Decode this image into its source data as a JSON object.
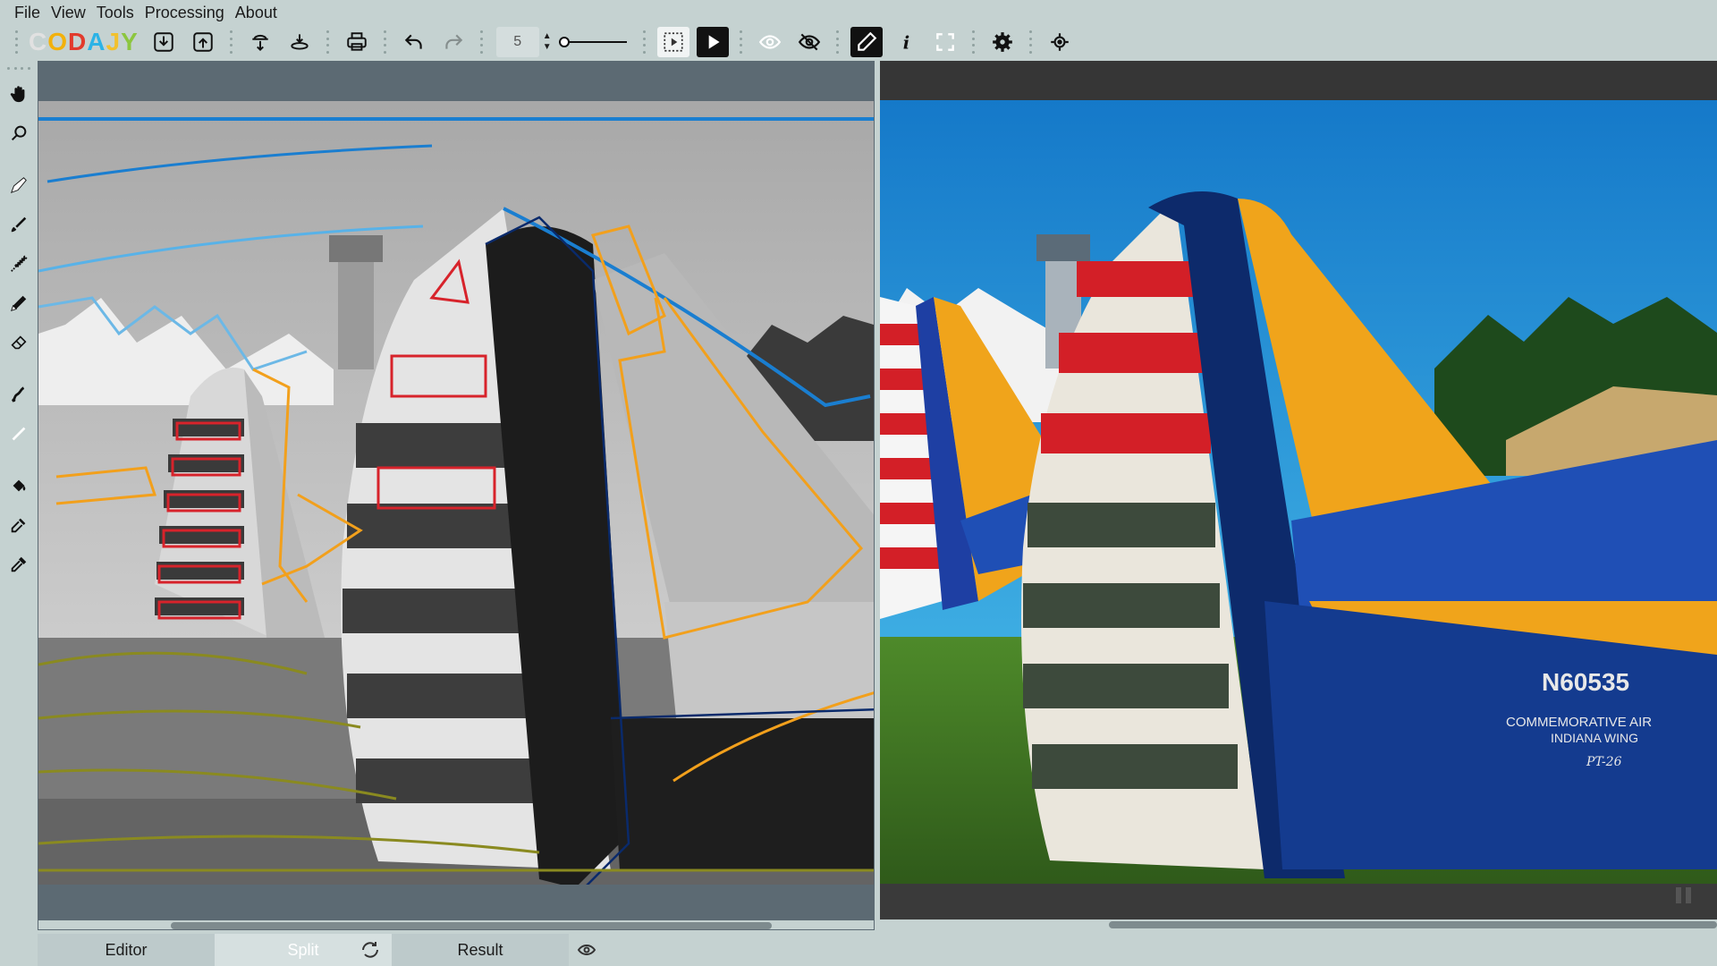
{
  "menu": {
    "items": [
      "File",
      "View",
      "Tools",
      "Processing",
      "About"
    ]
  },
  "toolbar": {
    "logo_letters": [
      "C",
      "O",
      "D",
      "A",
      "J",
      "Y"
    ],
    "logo_colors": [
      "#e1e1e1",
      "#f3b10b",
      "#e23a2c",
      "#2cb3e6",
      "#f2c12e",
      "#8cc63f"
    ],
    "brush_size": "5",
    "buttons": [
      "import-icon",
      "export-icon",
      "download-cloud-icon",
      "layers-icon",
      "print-icon",
      "undo-icon",
      "redo-icon",
      "compare-icon",
      "play-icon",
      "eye-icon",
      "eye-hidden-icon",
      "pen-icon",
      "info-icon",
      "fullscreen-icon",
      "settings-icon",
      "settings-alt-icon"
    ]
  },
  "left_tools": [
    "hand-icon",
    "zoom-icon",
    "pencil-icon",
    "brush-icon",
    "texture-brush-icon",
    "marker-icon",
    "eraser-icon",
    "smudge-icon",
    "line-icon",
    "fill-bucket-icon",
    "pipette-icon",
    "color-picker-icon"
  ],
  "tabs": {
    "editor": "Editor",
    "split": "Split",
    "result": "Result"
  },
  "colors": {
    "app_bg": "#c5d2d1",
    "editor_bg": "#5c6a73",
    "result_bg": "#363636",
    "stroke_red": "#d7232b",
    "stroke_orange": "#f2a01c",
    "stroke_blue": "#1a7ed0",
    "stroke_navy": "#0a2a6b",
    "stroke_olive": "#8a8a20"
  },
  "result_image_text": {
    "tail_number": "N60535",
    "org_line1": "COMMEMORATIVE AIR",
    "org_line2": "INDIANA WING",
    "model": "PT-26"
  }
}
